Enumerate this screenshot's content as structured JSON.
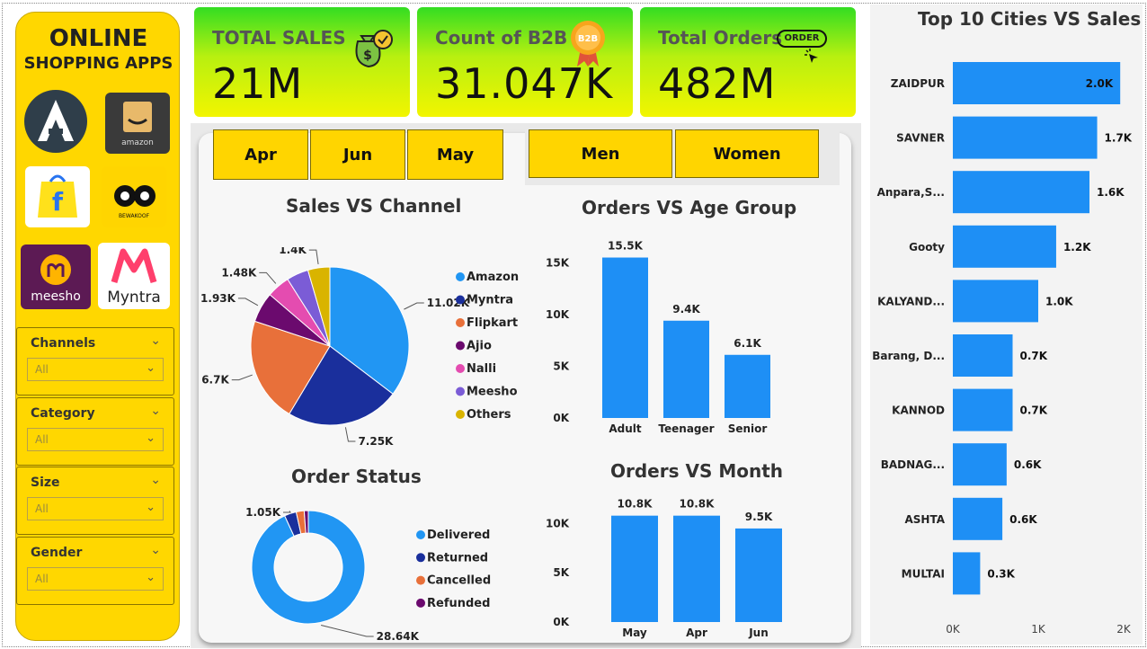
{
  "sidebar": {
    "brand_line1": "ONLINE",
    "brand_line2": "SHOPPING APPS",
    "logos": [
      {
        "name": "ajio-logo",
        "text": "A",
        "bg": "#2f3e4a",
        "fg": "#ffffff"
      },
      {
        "name": "amazon-logo",
        "text": "amazon",
        "bg": "#3a3a3a",
        "fg": "#e8b96a"
      },
      {
        "name": "flipkart-logo",
        "text": "f",
        "bg": "#ffe11b",
        "fg": "#2874f0"
      },
      {
        "name": "bewakoof-logo",
        "text": "BEWAKOOF",
        "bg": "#ffd500",
        "fg": "#111111"
      },
      {
        "name": "meesho-logo",
        "text": "meesho",
        "bg": "#5c1a54",
        "fg": "#ffffff"
      },
      {
        "name": "myntra-logo",
        "text": "Myntra",
        "bg": "#ffffff",
        "fg": "#222222"
      }
    ],
    "filters": [
      {
        "title": "Channels",
        "value": "All"
      },
      {
        "title": "Category",
        "value": "All"
      },
      {
        "title": "Size",
        "value": "All"
      },
      {
        "title": "Gender",
        "value": "All"
      }
    ]
  },
  "kpis": [
    {
      "label": "TOTAL SALES",
      "value": "21M",
      "icon": "money-bag-icon"
    },
    {
      "label": "Count of B2B",
      "value": "31.047K",
      "icon": "b2b-badge-icon"
    },
    {
      "label": "Total Orders",
      "value": "482M",
      "icon": "order-click-icon",
      "badge": "ORDER"
    }
  ],
  "month_slicer": [
    "Apr",
    "Jun",
    "May"
  ],
  "gender_slicer": [
    "Men",
    "Women"
  ],
  "colors": {
    "Amazon": "#2196f3",
    "Myntra": "#1a2f9c",
    "Flipkart": "#e8703a",
    "Ajio": "#6b0a6e",
    "Nalli": "#e44cb0",
    "Meesho": "#7b5cd6",
    "Others": "#d9b400",
    "Delivered": "#2196f3",
    "Returned": "#1a2f9c",
    "Cancelled": "#e8703a",
    "Refunded": "#6b0a6e",
    "bar": "#1e8ff5"
  },
  "chart_data": [
    {
      "id": "sales_vs_channel",
      "type": "pie",
      "title": "Sales VS Channel",
      "categories": [
        "Amazon",
        "Myntra",
        "Flipkart",
        "Ajio",
        "Nalli",
        "Meesho",
        "Others"
      ],
      "values": [
        11020,
        7250,
        6700,
        1930,
        1480,
        1400,
        1400
      ],
      "data_labels": [
        "11.02K",
        "7.25K",
        "6.7K",
        "1.93K",
        "1.48K",
        "",
        "1.4K"
      ],
      "legend": "right"
    },
    {
      "id": "orders_vs_age_group",
      "type": "bar",
      "title": "Orders VS Age Group",
      "categories": [
        "Adult",
        "Teenager",
        "Senior"
      ],
      "values": [
        15500,
        9400,
        6100
      ],
      "data_labels": [
        "15.5K",
        "9.4K",
        "6.1K"
      ],
      "ylim": [
        0,
        16500
      ],
      "yticks": [
        0,
        5000,
        10000,
        15000
      ],
      "ytick_labels": [
        "0K",
        "5K",
        "10K",
        "15K"
      ],
      "grid": false
    },
    {
      "id": "order_status",
      "type": "pie",
      "title": "Order Status",
      "categories": [
        "Delivered",
        "Returned",
        "Cancelled",
        "Refunded"
      ],
      "values": [
        28640,
        1050,
        700,
        360
      ],
      "data_labels": [
        "28.64K",
        "1.05K",
        "",
        ""
      ],
      "legend": "right"
    },
    {
      "id": "orders_vs_month",
      "type": "bar",
      "title": "Orders VS Month",
      "categories": [
        "May",
        "Apr",
        "Jun"
      ],
      "values": [
        10800,
        10800,
        9500
      ],
      "data_labels": [
        "10.8K",
        "10.8K",
        "9.5K"
      ],
      "ylim": [
        0,
        11500
      ],
      "yticks": [
        0,
        5000,
        10000
      ],
      "ytick_labels": [
        "0K",
        "5K",
        "10K"
      ],
      "grid": false
    },
    {
      "id": "top10_cities_vs_sales",
      "type": "bar",
      "orientation": "horizontal",
      "title": "Top 10 Cities VS Sales",
      "categories": [
        "ZAIDPUR",
        "SAVNER",
        "Anpara,S...",
        "Gooty",
        "KALYAND...",
        "Barang, D...",
        "KANNOD",
        "BADNAG...",
        "ASHTA",
        "MULTAI"
      ],
      "values": [
        1960,
        1690,
        1600,
        1210,
        1000,
        700,
        700,
        630,
        580,
        320
      ],
      "data_labels": [
        "2.0K",
        "1.7K",
        "1.6K",
        "1.2K",
        "1.0K",
        "0.7K",
        "0.7K",
        "0.6K",
        "0.6K",
        "0.3K"
      ],
      "xlim": [
        0,
        2000
      ],
      "xticks": [
        0,
        1000,
        2000
      ],
      "xtick_labels": [
        "0K",
        "1K",
        "2K"
      ],
      "grid": false
    }
  ]
}
